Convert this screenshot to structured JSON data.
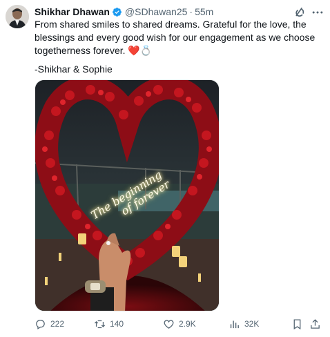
{
  "author": {
    "name": "Shikhar Dhawan",
    "handle": "@SDhawan25",
    "separator": "·",
    "time": "55m",
    "verified_color": "#1d9bf0"
  },
  "tweet": {
    "text": "From shared smiles to shared dreams. Grateful for the love, the blessings and every good wish for our engagement as we choose togetherness forever. ❤️💍",
    "signature": "-Shikhar & Sophie"
  },
  "media": {
    "neon_line1": "The beginning",
    "neon_line2": "of forever"
  },
  "icons": {
    "reply": "reply-icon",
    "retweet": "retweet-icon",
    "like": "heart-icon",
    "views": "views-icon",
    "bookmark": "bookmark-icon",
    "share": "share-icon",
    "grok": "grok-icon",
    "more": "more-icon"
  },
  "actions": {
    "replies": "222",
    "retweets": "140",
    "likes": "2.9K",
    "views": "32K"
  },
  "colors": {
    "text": "#0f1419",
    "secondary": "#536471",
    "rose": "#b3121c"
  }
}
